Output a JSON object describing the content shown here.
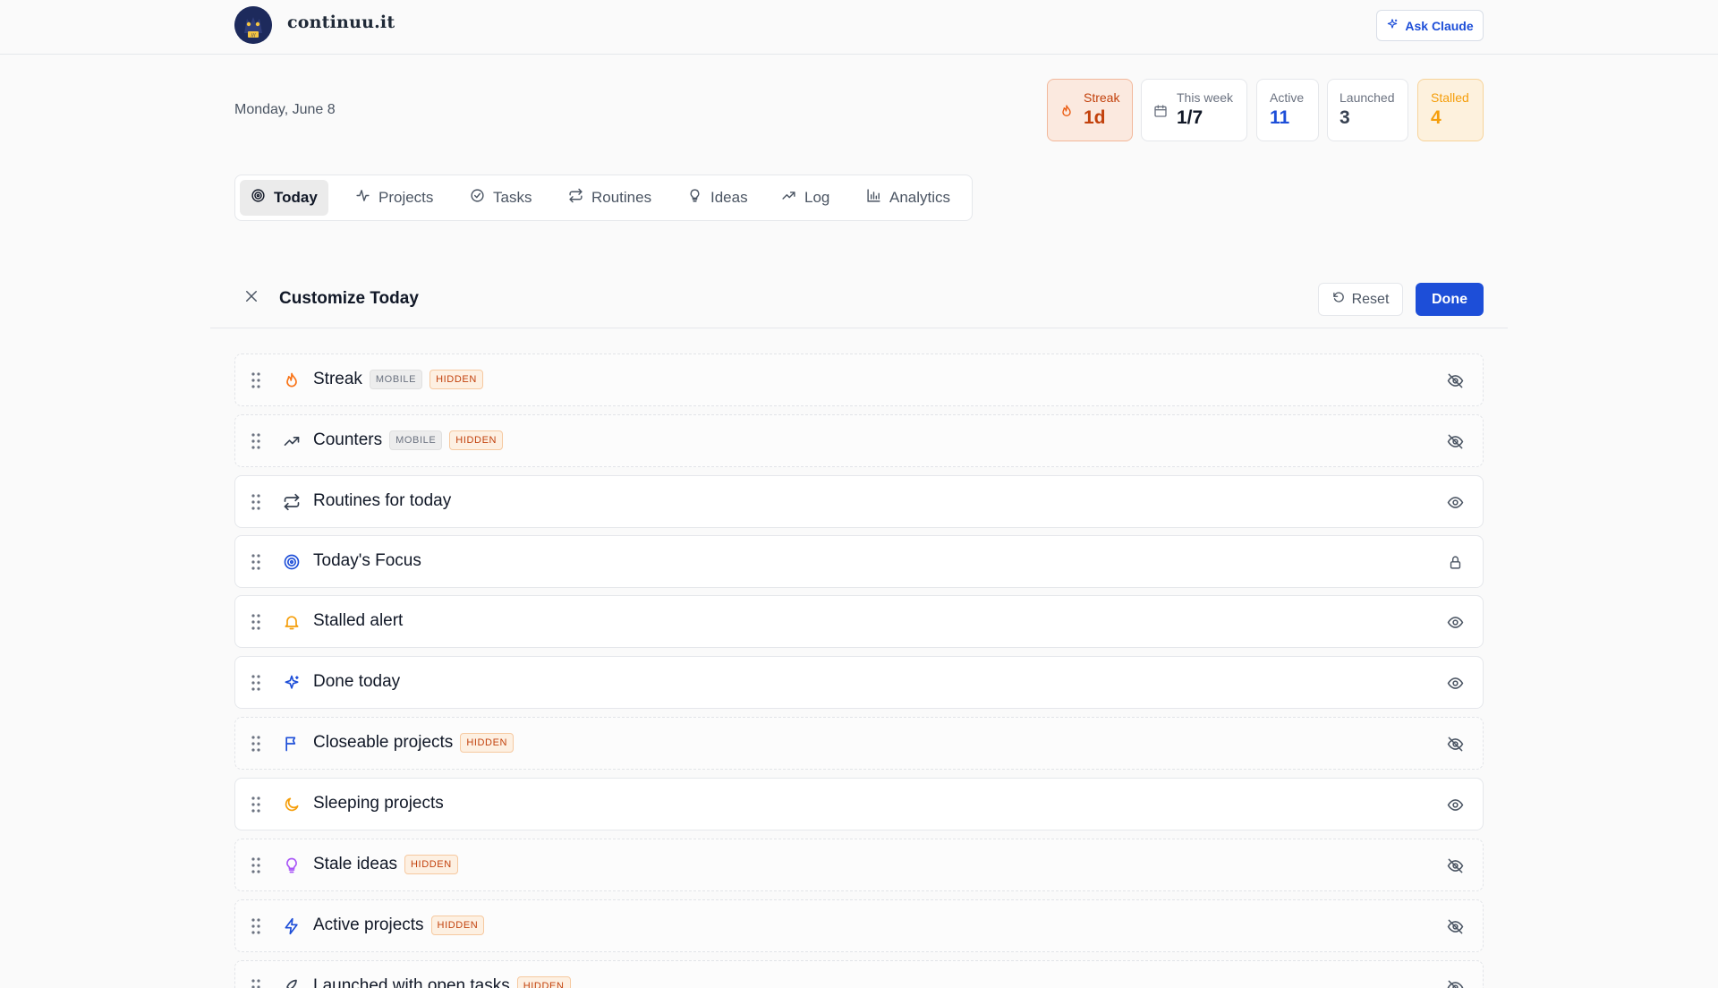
{
  "app": {
    "brand": "continuu.it",
    "ask_label": "Ask Claude"
  },
  "date": "Monday, June 8",
  "stats": {
    "streak": {
      "label": "Streak",
      "value": "1d"
    },
    "week": {
      "label": "This week",
      "value": "1/7"
    },
    "active": {
      "label": "Active",
      "value": "11"
    },
    "launched": {
      "label": "Launched",
      "value": "3"
    },
    "stalled": {
      "label": "Stalled",
      "value": "4"
    }
  },
  "tabs": [
    {
      "label": "Today",
      "icon": "target-icon",
      "active": true
    },
    {
      "label": "Projects",
      "icon": "activity-icon"
    },
    {
      "label": "Tasks",
      "icon": "check-circle-icon"
    },
    {
      "label": "Routines",
      "icon": "repeat-icon"
    },
    {
      "label": "Ideas",
      "icon": "lightbulb-icon"
    },
    {
      "label": "Log",
      "icon": "trending-up-icon"
    },
    {
      "label": "Analytics",
      "icon": "bar-chart-icon"
    }
  ],
  "customize": {
    "title": "Customize Today",
    "reset_label": "Reset",
    "done_label": "Done"
  },
  "sections": [
    {
      "label": "Streak",
      "icon": "flame-icon",
      "badges": [
        "MOBILE",
        "HIDDEN"
      ],
      "visibility": "eye-off-icon"
    },
    {
      "label": "Counters",
      "icon": "trending-up-icon",
      "badges": [
        "MOBILE",
        "HIDDEN"
      ],
      "visibility": "eye-off-icon"
    },
    {
      "label": "Routines for today",
      "icon": "repeat-icon",
      "badges": [],
      "visibility": "eye-icon"
    },
    {
      "label": "Today's Focus",
      "icon": "target-icon",
      "badges": [],
      "visibility": "lock-icon"
    },
    {
      "label": "Stalled alert",
      "icon": "bell-icon",
      "badges": [],
      "visibility": "eye-icon"
    },
    {
      "label": "Done today",
      "icon": "sparkles-icon",
      "badges": [],
      "visibility": "eye-icon"
    },
    {
      "label": "Closeable projects",
      "icon": "flag-icon",
      "badges": [
        "HIDDEN"
      ],
      "visibility": "eye-off-icon"
    },
    {
      "label": "Sleeping projects",
      "icon": "moon-icon",
      "badges": [],
      "visibility": "eye-icon"
    },
    {
      "label": "Stale ideas",
      "icon": "lightbulb-icon",
      "badges": [
        "HIDDEN"
      ],
      "visibility": "eye-off-icon"
    },
    {
      "label": "Active projects",
      "icon": "zap-icon",
      "badges": [
        "HIDDEN"
      ],
      "visibility": "eye-off-icon"
    },
    {
      "label": "Launched with open tasks",
      "icon": "rocket-icon",
      "badges": [
        "HIDDEN"
      ],
      "visibility": "eye-off-icon"
    }
  ],
  "colors": {
    "accent": "#1d4ed8",
    "streak": "#c2410c",
    "stalled": "#f59e0b",
    "hidden_badge": "#c2410c"
  }
}
